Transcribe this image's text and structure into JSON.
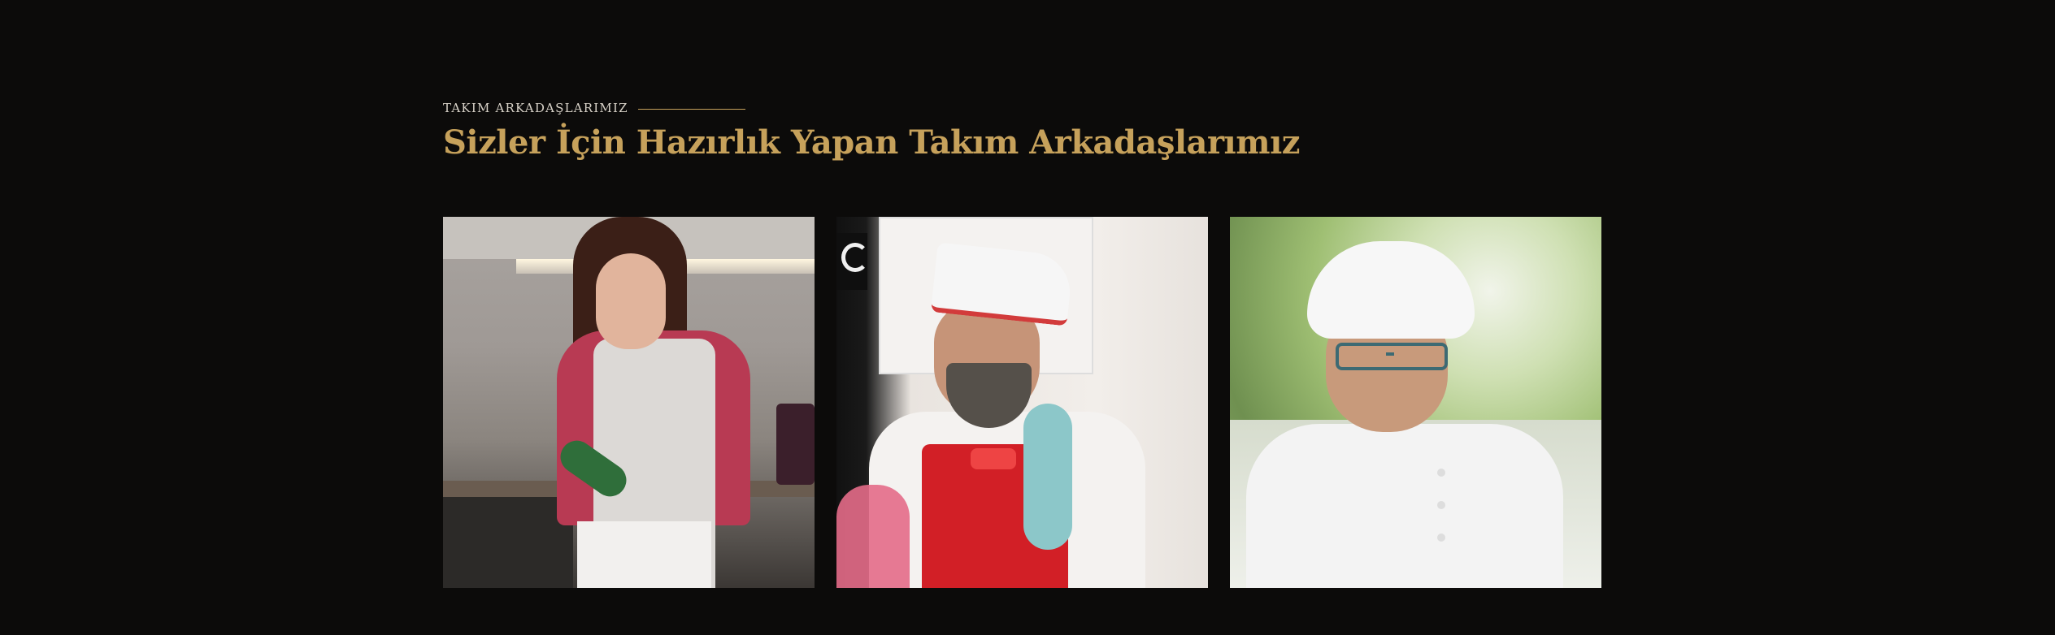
{
  "section": {
    "eyebrow": "TAKIM ARKADAŞLARIMIZ",
    "title": "Sizler İçin Hazırlık Yapan Takım Arkadaşlarımız"
  },
  "team": {
    "members": [
      {
        "photo": "woman-pastry-chef-photo"
      },
      {
        "photo": "bearded-chef-photo"
      },
      {
        "photo": "chef-with-glasses-photo"
      }
    ]
  },
  "colors": {
    "background": "#0c0b0a",
    "accent": "#c6a15b",
    "eyebrow_text": "#d8d2c8"
  }
}
